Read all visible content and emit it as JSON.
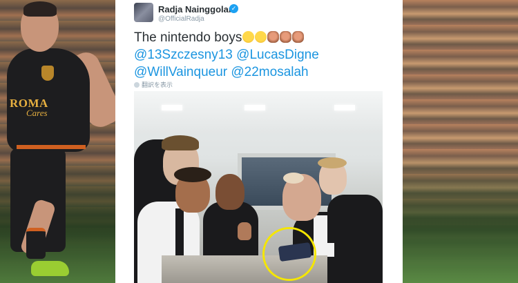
{
  "tweet": {
    "author_name": "Radja Nainggolan",
    "author_handle": "@OfficialRadja",
    "text_line1": "The nintendo boys",
    "emojis": [
      "face-with-tears-of-joy",
      "face-with-tears-of-joy",
      "see-no-evil-monkey",
      "see-no-evil-monkey",
      "see-no-evil-monkey"
    ],
    "mentions_line2": [
      "@13Szczesny13",
      "@LucasDigne"
    ],
    "mentions_line3": [
      "@WillVainqueur",
      "@22mosalah"
    ],
    "translate_label": "翻訳を表示",
    "verified": true
  },
  "background": {
    "sponsor_line1": "ROMA",
    "sponsor_line2": "Cares"
  },
  "colors": {
    "link": "#1b95e0",
    "highlight": "#f5e600",
    "verified": "#1da1f2"
  }
}
